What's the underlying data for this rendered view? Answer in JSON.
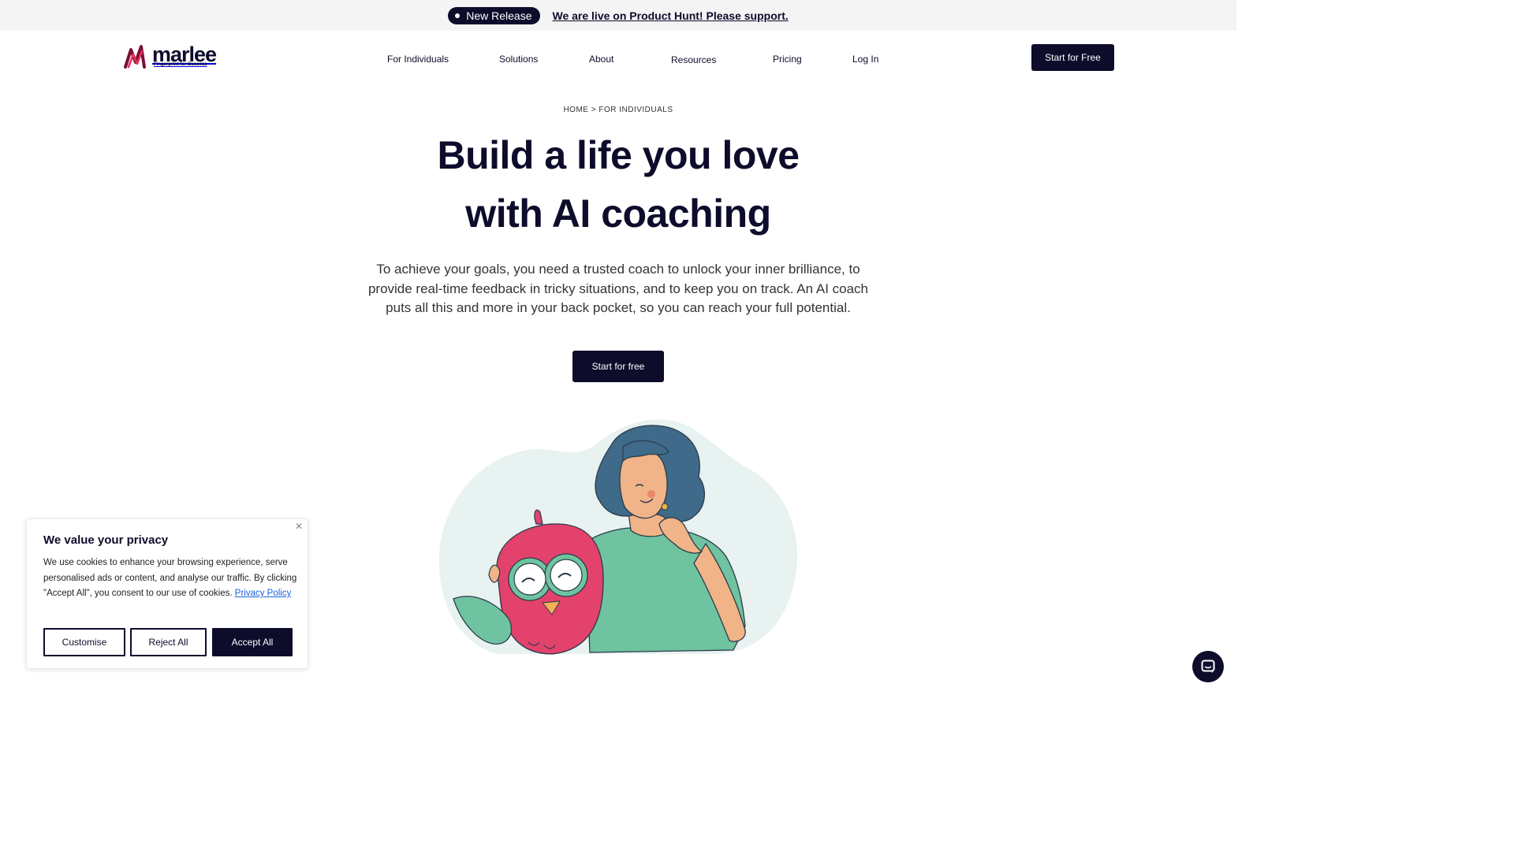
{
  "announcement": {
    "badge": "New Release",
    "link_text": "We are live on Product Hunt! Please support."
  },
  "brand": {
    "name": "marlee",
    "tagline": "Fingerprint for Success",
    "colors": {
      "navy": "#0d0c2b",
      "logo_red": "#e5305a",
      "logo_dark_red": "#7a1130"
    }
  },
  "nav": {
    "items": [
      {
        "label": "For Individuals"
      },
      {
        "label": "Solutions"
      },
      {
        "label": "About"
      },
      {
        "label": "Resources"
      },
      {
        "label": "Pricing"
      },
      {
        "label": "Log In"
      }
    ],
    "cta": "Start for Free"
  },
  "breadcrumb": "HOME > FOR INDIVIDUALS",
  "hero": {
    "title_line1": "Build a life you love",
    "title_line2": "with AI coaching",
    "description": "To achieve your goals, you need a trusted coach to unlock your inner brilliance, to provide real-time feedback in tricky situations, and to keep you on track. An AI coach puts all this and more in your back pocket, so you can reach your full potential.",
    "cta": "Start for free"
  },
  "illustration": {
    "icons": [
      "owl-mascot",
      "smiling-woman"
    ],
    "colors": {
      "blob": "#e7f2f1",
      "hair": "#3f6a8a",
      "skin": "#f0b488",
      "shirt": "#6fc3a0",
      "owl": "#e2426b"
    }
  },
  "cookie_banner": {
    "title": "We value your privacy",
    "body": "We use cookies to enhance your browsing experience, serve personalised ads or content, and analyse our traffic. By clicking \"Accept All\", you consent to our use of cookies.",
    "policy_link": "Privacy Policy",
    "buttons": {
      "customise": "Customise",
      "reject": "Reject All",
      "accept": "Accept All"
    },
    "close_icon": "close-icon"
  },
  "chat_widget": {
    "icon": "chat-icon"
  }
}
